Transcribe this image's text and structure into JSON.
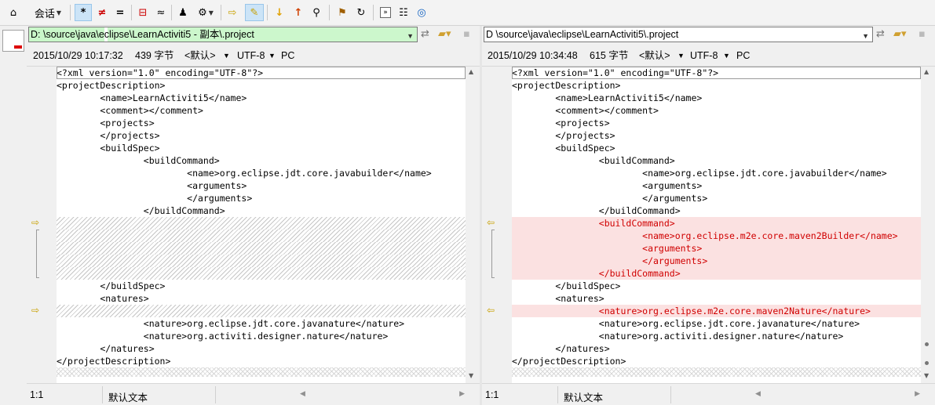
{
  "toolbar": {
    "session_label": "会话",
    "items": [
      {
        "name": "session-menu",
        "glyph": "⌂"
      },
      {
        "name": "all-lines",
        "glyph": "*"
      },
      {
        "name": "diffs-only",
        "glyph": "≠"
      },
      {
        "name": "same-only",
        "glyph": "="
      },
      {
        "name": "show-context",
        "glyph": "⊟"
      },
      {
        "name": "ignore-unimportant",
        "glyph": "≈"
      },
      {
        "name": "rules",
        "glyph": "♟"
      },
      {
        "name": "format",
        "glyph": "⚙"
      },
      {
        "name": "swap-sides",
        "glyph": "⇨"
      },
      {
        "name": "edit",
        "glyph": "✎"
      },
      {
        "name": "next-diff",
        "glyph": "↓"
      },
      {
        "name": "prev-diff",
        "glyph": "↑"
      },
      {
        "name": "find",
        "glyph": "⚲"
      },
      {
        "name": "bookmark",
        "glyph": "⚑"
      },
      {
        "name": "refresh",
        "glyph": "↻"
      },
      {
        "name": "next-section",
        "glyph": "»"
      },
      {
        "name": "report",
        "glyph": "☷"
      },
      {
        "name": "web",
        "glyph": "◎"
      }
    ]
  },
  "left": {
    "path": "D:                    \\source\\java\\eclipse\\LearnActiviti5 - 副本\\.project",
    "date": "2015/10/29 10:17:32",
    "size": "439 字节",
    "encoding_name": "<默认>",
    "charset": "UTF-8",
    "line_endings": "PC",
    "status_pos": "1:1",
    "status_encoding": "默认文本",
    "lines": [
      {
        "t": "<?xml version=\"1.0\" encoding=\"UTF-8\"?>",
        "k": "first"
      },
      {
        "t": "<projectDescription>",
        "k": ""
      },
      {
        "t": "        <name>LearnActiviti5</name>",
        "k": ""
      },
      {
        "t": "        <comment></comment>",
        "k": ""
      },
      {
        "t": "        <projects>",
        "k": ""
      },
      {
        "t": "        </projects>",
        "k": ""
      },
      {
        "t": "        <buildSpec>",
        "k": ""
      },
      {
        "t": "                <buildCommand>",
        "k": ""
      },
      {
        "t": "                        <name>org.eclipse.jdt.core.javabuilder</name>",
        "k": ""
      },
      {
        "t": "                        <arguments>",
        "k": ""
      },
      {
        "t": "                        </arguments>",
        "k": ""
      },
      {
        "t": "                </buildCommand>",
        "k": ""
      },
      {
        "t": "",
        "k": "hatched"
      },
      {
        "t": "",
        "k": "hatched"
      },
      {
        "t": "",
        "k": "hatched"
      },
      {
        "t": "",
        "k": "hatched"
      },
      {
        "t": "",
        "k": "hatched"
      },
      {
        "t": "        </buildSpec>",
        "k": ""
      },
      {
        "t": "        <natures>",
        "k": ""
      },
      {
        "t": "",
        "k": "hatched"
      },
      {
        "t": "                <nature>org.eclipse.jdt.core.javanature</nature>",
        "k": ""
      },
      {
        "t": "                <nature>org.activiti.designer.nature</nature>",
        "k": ""
      },
      {
        "t": "        </natures>",
        "k": ""
      },
      {
        "t": "</projectDescription>",
        "k": ""
      },
      {
        "t": "",
        "k": "cross"
      }
    ]
  },
  "right": {
    "path": "D                    \\source\\java\\eclipse\\LearnActiviti5\\.project",
    "date": "2015/10/29 10:34:48",
    "size": "615 字节",
    "encoding_name": "<默认>",
    "charset": "UTF-8",
    "line_endings": "PC",
    "status_pos": "1:1",
    "status_encoding": "默认文本",
    "lines": [
      {
        "t": "<?xml version=\"1.0\" encoding=\"UTF-8\"?>",
        "k": "first"
      },
      {
        "t": "<projectDescription>",
        "k": ""
      },
      {
        "t": "        <name>LearnActiviti5</name>",
        "k": ""
      },
      {
        "t": "        <comment></comment>",
        "k": ""
      },
      {
        "t": "        <projects>",
        "k": ""
      },
      {
        "t": "        </projects>",
        "k": ""
      },
      {
        "t": "        <buildSpec>",
        "k": ""
      },
      {
        "t": "                <buildCommand>",
        "k": ""
      },
      {
        "t": "                        <name>org.eclipse.jdt.core.javabuilder</name>",
        "k": ""
      },
      {
        "t": "                        <arguments>",
        "k": ""
      },
      {
        "t": "                        </arguments>",
        "k": ""
      },
      {
        "t": "                </buildCommand>",
        "k": ""
      },
      {
        "t": "                <buildCommand>",
        "k": "diff"
      },
      {
        "t": "                        <name>org.eclipse.m2e.core.maven2Builder</name>",
        "k": "diff"
      },
      {
        "t": "                        <arguments>",
        "k": "diff"
      },
      {
        "t": "                        </arguments>",
        "k": "diff"
      },
      {
        "t": "                </buildCommand>",
        "k": "diff"
      },
      {
        "t": "        </buildSpec>",
        "k": ""
      },
      {
        "t": "        <natures>",
        "k": ""
      },
      {
        "t": "                <nature>org.eclipse.m2e.core.maven2Nature</nature>",
        "k": "diff"
      },
      {
        "t": "                <nature>org.eclipse.jdt.core.javanature</nature>",
        "k": ""
      },
      {
        "t": "                <nature>org.activiti.designer.nature</nature>",
        "k": ""
      },
      {
        "t": "        </natures>",
        "k": ""
      },
      {
        "t": "</projectDescription>",
        "k": ""
      },
      {
        "t": "",
        "k": "cross"
      }
    ]
  },
  "colors": {
    "diff_bg": "#fbe1e1",
    "diff_text": "#d00000",
    "path_left_bg": "#ccf7cc",
    "marker": "#c8a000"
  },
  "markers": {
    "left_arrow": "⇨",
    "right_arrow": "⇦"
  }
}
